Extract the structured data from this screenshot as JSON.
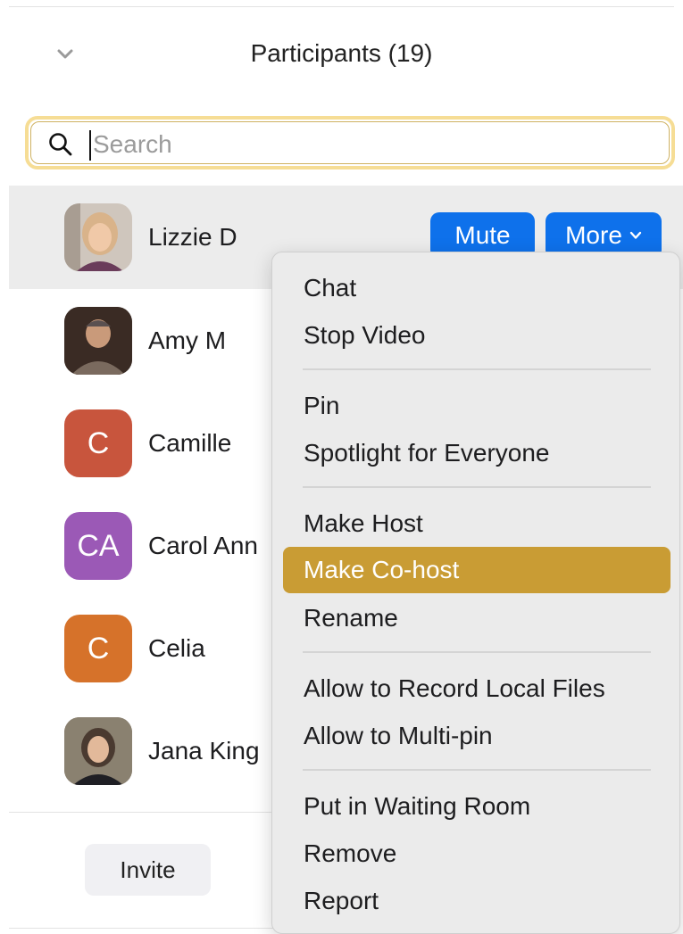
{
  "panel": {
    "title": "Participants (19)",
    "collapse_icon": "chevron-down-icon"
  },
  "search": {
    "placeholder": "Search",
    "value": "",
    "icon": "search-icon",
    "focus_color": "#f6dd95"
  },
  "participants": [
    {
      "name": "Lizzie D",
      "avatar": "photo",
      "selected": true
    },
    {
      "name": "Amy M",
      "avatar": "photo"
    },
    {
      "name": "Camille",
      "avatar": "initials",
      "initials": "C",
      "color": "#c8553d"
    },
    {
      "name": "Carol Ann",
      "avatar": "initials",
      "initials": "CA",
      "color": "#9b59b6"
    },
    {
      "name": "Celia",
      "avatar": "initials",
      "initials": "C",
      "color": "#d6722a"
    },
    {
      "name": "Jana King",
      "avatar": "photo"
    }
  ],
  "row_actions": {
    "mute_label": "Mute",
    "more_label": "More",
    "button_color": "#0e71eb"
  },
  "more_menu": {
    "highlight_color": "#c99c34",
    "groups": [
      [
        "Chat",
        "Stop Video"
      ],
      [
        "Pin",
        "Spotlight for Everyone"
      ],
      [
        "Make Host",
        "Make Co-host",
        "Rename"
      ],
      [
        "Allow to Record Local Files",
        "Allow to Multi-pin"
      ],
      [
        "Put in Waiting Room",
        "Remove",
        "Report"
      ]
    ],
    "highlighted": "Make Co-host"
  },
  "footer": {
    "invite_label": "Invite"
  }
}
